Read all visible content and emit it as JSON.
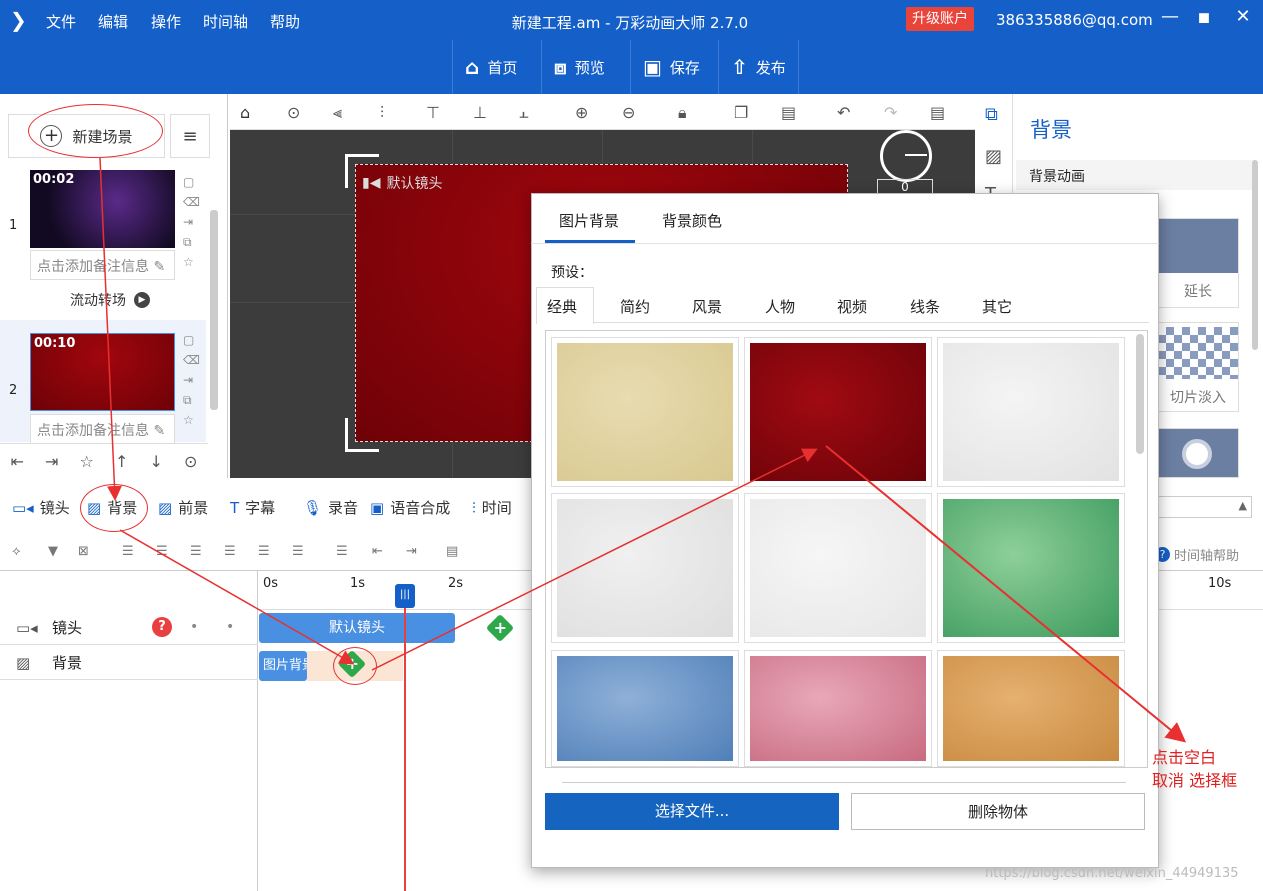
{
  "titlebar": {
    "menu": [
      "文件",
      "编辑",
      "操作",
      "时间轴",
      "帮助"
    ],
    "title": "新建工程.am - 万彩动画大师 2.7.0",
    "upgrade": "升级账户",
    "account": "386335886@qq.com"
  },
  "toolbar": {
    "home": "首页",
    "preview": "预览",
    "save": "保存",
    "publish": "发布"
  },
  "scenes": {
    "new_scene": "新建场景",
    "items": [
      {
        "num": "1",
        "time": "00:02",
        "note": "点击添加备注信息"
      },
      {
        "num": "2",
        "time": "00:10",
        "note": "点击添加备注信息"
      }
    ],
    "transition": "流动转场"
  },
  "canvas": {
    "camera_label": "默认镜头",
    "clock_value": "0"
  },
  "right_panel": {
    "title": "背景",
    "section": "背景动画",
    "anims": [
      "延长",
      "切片淡入"
    ]
  },
  "bottom_tabs": [
    "镜头",
    "背景",
    "前景",
    "字幕",
    "录音",
    "语音合成",
    "时间"
  ],
  "timeline": {
    "help": "时间轴帮助",
    "ruler": [
      "0s",
      "1s",
      "2s",
      "10s"
    ],
    "tracks": [
      {
        "name": "镜头"
      },
      {
        "name": "背景"
      }
    ],
    "camera_clip": "默认镜头",
    "bg_clip": "图片背景"
  },
  "dialog": {
    "tabs": [
      "图片背景",
      "背景颜色"
    ],
    "preset": "预设：",
    "categories": [
      "经典",
      "简约",
      "风景",
      "人物",
      "视频",
      "线条",
      "其它"
    ],
    "choose_file": "选择文件...",
    "delete_object": "删除物体",
    "tiles": [
      {
        "name": "parchment",
        "colors": [
          "#e8dcb0",
          "#d8c890"
        ]
      },
      {
        "name": "dark-red",
        "colors": [
          "#a10a12",
          "#6a0308"
        ]
      },
      {
        "name": "white-poly",
        "colors": [
          "#f4f4f4",
          "#e2e2e2"
        ]
      },
      {
        "name": "light-grey-poly",
        "colors": [
          "#f0f0f0",
          "#dedede"
        ]
      },
      {
        "name": "white-poly-2",
        "colors": [
          "#f6f6f6",
          "#e6e6e6"
        ]
      },
      {
        "name": "green-watercolor",
        "colors": [
          "#8ecf9a",
          "#3c9a5c"
        ]
      },
      {
        "name": "blue-watercolor",
        "colors": [
          "#8fb0d8",
          "#4f7fb8"
        ]
      },
      {
        "name": "pink-watercolor",
        "colors": [
          "#e8a8b8",
          "#c86a80"
        ]
      },
      {
        "name": "wood",
        "colors": [
          "#e6b070",
          "#c88a40"
        ]
      }
    ]
  },
  "annotation": {
    "line1": "点击空白",
    "line2": "取消 选择框"
  },
  "watermark": "https://blog.csdn.net/weixin_44949135",
  "colors": {
    "accent": "#1560c8",
    "upgrade": "#e8443a",
    "annotation": "#e02020"
  }
}
